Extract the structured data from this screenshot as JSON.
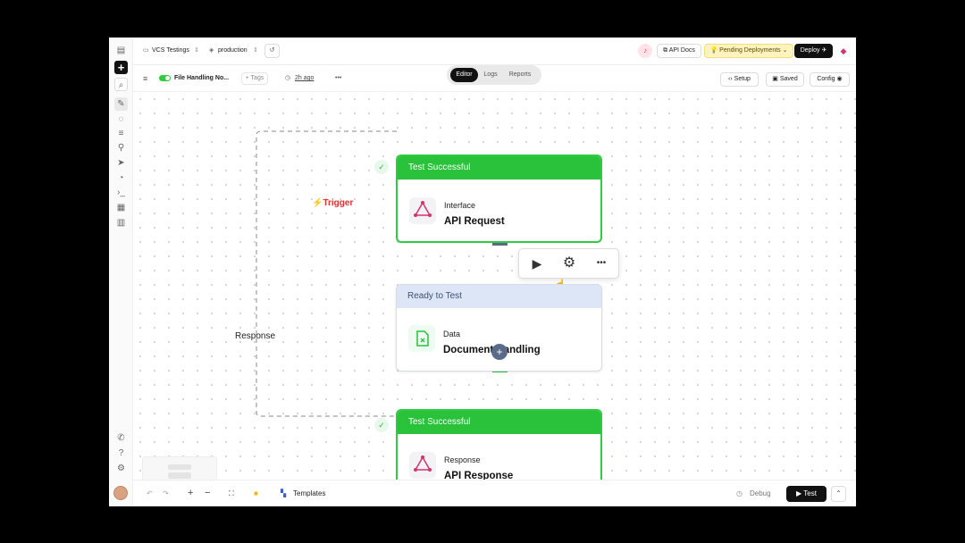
{
  "header": {
    "project": "VCS Testings",
    "environment": "production",
    "api_docs": "API Docs",
    "pending": "Pending Deployments",
    "deploy": "Deploy"
  },
  "toolbar": {
    "workflow_name": "File Handling No...",
    "tags": "+ Tags",
    "time_ago": "2h ago",
    "more": "•••",
    "tabs": [
      {
        "label": "Editor",
        "active": true
      },
      {
        "label": "Logs",
        "active": false
      },
      {
        "label": "Reports",
        "active": false
      }
    ],
    "setup": "Setup",
    "saved": "Saved",
    "config": "Config"
  },
  "canvas": {
    "trigger_label": "⚡Trigger",
    "response_label": "Response",
    "nodes": [
      {
        "status": "Test Successful",
        "category": "Interface",
        "title": "API Request"
      },
      {
        "status": "Ready to Test",
        "category": "Data",
        "title": "Document Handling"
      },
      {
        "status": "Test Successful",
        "category": "Response",
        "title": "API Response"
      }
    ],
    "add_step": "+"
  },
  "bottom": {
    "templates": "Templates",
    "debug": "Debug",
    "test": "Test"
  },
  "colors": {
    "success": "#29c23a",
    "ready": "#dde6f7",
    "accent_pink": "#d6336c",
    "trigger_red": "#e03131",
    "pending_bg": "#fff3bf"
  }
}
